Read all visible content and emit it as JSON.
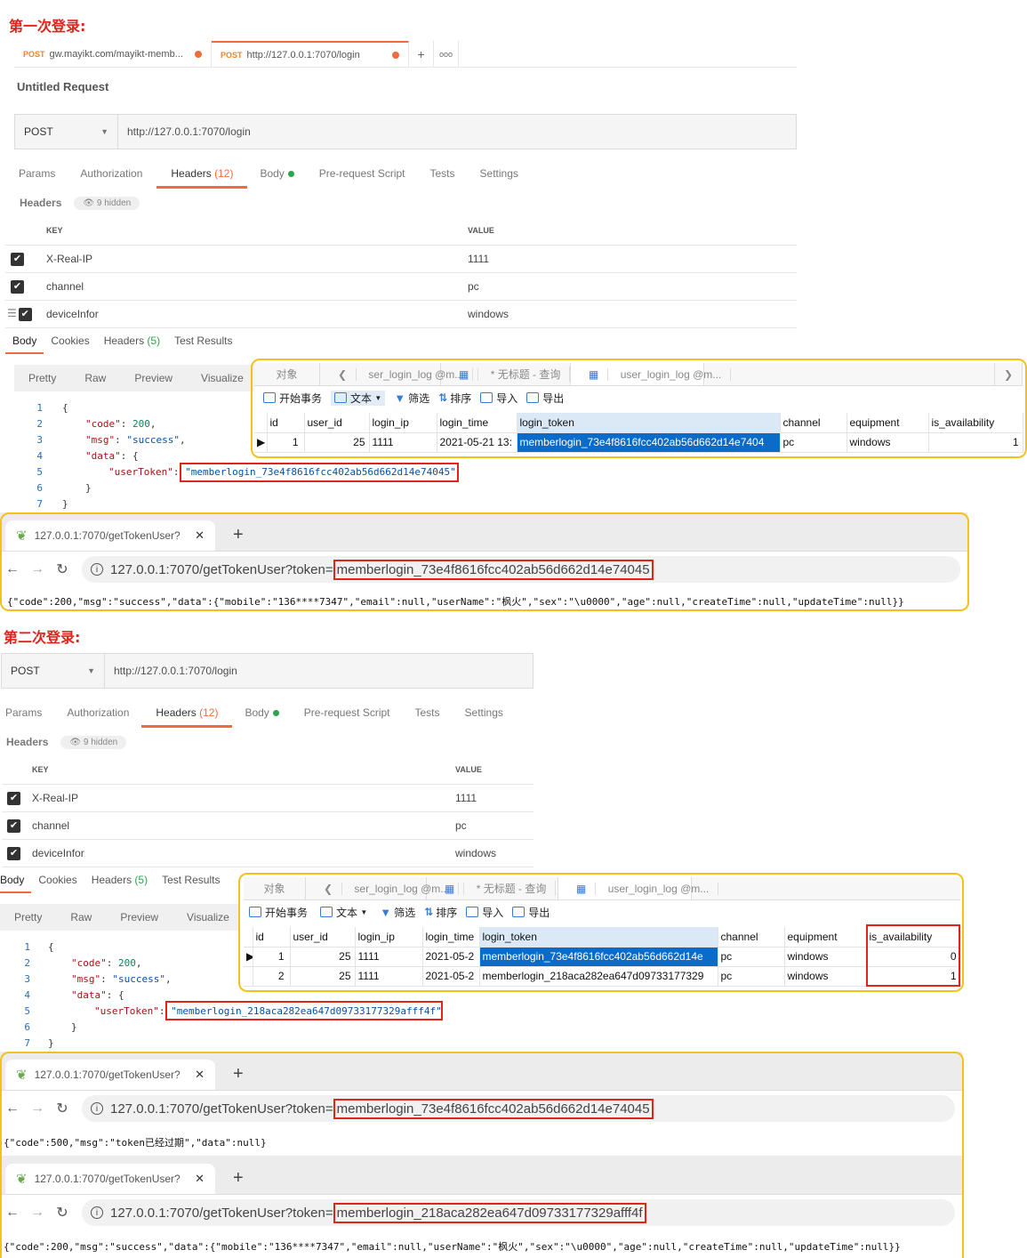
{
  "headings": {
    "first": "第一次登录:",
    "second": "第二次登录:"
  },
  "postman1": {
    "tabs": [
      {
        "method": "POST",
        "label": "gw.mayikt.com/mayikt-memb..."
      },
      {
        "method": "POST",
        "label": "http://127.0.0.1:7070/login"
      }
    ],
    "tab_plus": "+",
    "tab_more": "ooo",
    "request_title": "Untitled Request",
    "method": "POST",
    "url": "http://127.0.0.1:7070/login",
    "req_tabs": [
      "Params",
      "Authorization",
      "Headers",
      "(12)",
      "Body",
      "Pre-request Script",
      "Tests",
      "Settings"
    ],
    "headers_label": "Headers",
    "hidden_label": "9 hidden",
    "key_col": "KEY",
    "value_col": "VALUE",
    "rows": [
      {
        "key": "X-Real-IP",
        "value": "1111"
      },
      {
        "key": "channel",
        "value": "pc"
      },
      {
        "key": "deviceInfor",
        "value": "windows"
      }
    ],
    "resp_tabs": [
      "Body",
      "Cookies",
      "Headers",
      "(5)",
      "Test Results"
    ],
    "view_tabs": [
      "Pretty",
      "Raw",
      "Preview",
      "Visualize"
    ],
    "code": {
      "k_code": "\"code\"",
      "v_code": "200",
      "k_msg": "\"msg\"",
      "v_msg": "\"success\"",
      "k_data": "\"data\"",
      "k_token": "\"userToken\"",
      "v_token": "\"memberlogin_73e4f8616fcc402ab56d662d14e74045\""
    },
    "line_numbers": [
      "1",
      "2",
      "3",
      "4",
      "5",
      "6",
      "7"
    ]
  },
  "navicat1": {
    "tabs": [
      "对象",
      "ser_login_log @m...",
      "* 无标题 - 查询",
      "user_login_log @m..."
    ],
    "tools": [
      "开始事务",
      "文本",
      "筛选",
      "排序",
      "导入",
      "导出"
    ],
    "columns": [
      "id",
      "user_id",
      "login_ip",
      "login_time",
      "login_token",
      "channel",
      "equipment",
      "is_availability"
    ],
    "rows": [
      [
        "1",
        "25",
        "1111",
        "2021-05-21 13:",
        "memberlogin_73e4f8616fcc402ab56d662d14e7404",
        "pc",
        "windows",
        "1"
      ]
    ]
  },
  "browser1": {
    "tab_title": "127.0.0.1:7070/getTokenUser?",
    "url_prefix": "127.0.0.1:7070/getTokenUser?token=",
    "url_token": "memberlogin_73e4f8616fcc402ab56d662d14e74045",
    "response": "{\"code\":200,\"msg\":\"success\",\"data\":{\"mobile\":\"136****7347\",\"email\":null,\"userName\":\"枫火\",\"sex\":\"\\u0000\",\"age\":null,\"createTime\":null,\"updateTime\":null}}"
  },
  "postman2": {
    "method": "POST",
    "url": "http://127.0.0.1:7070/login",
    "req_tabs": [
      "Params",
      "Authorization",
      "Headers",
      "(12)",
      "Body",
      "Pre-request Script",
      "Tests",
      "Settings"
    ],
    "headers_label": "Headers",
    "hidden_label": "9 hidden",
    "key_col": "KEY",
    "value_col": "VALUE",
    "rows": [
      {
        "key": "X-Real-IP",
        "value": "1111"
      },
      {
        "key": "channel",
        "value": "pc"
      },
      {
        "key": "deviceInfor",
        "value": "windows"
      }
    ],
    "resp_tabs": [
      "Body",
      "Cookies",
      "Headers",
      "(5)",
      "Test Results"
    ],
    "view_tabs": [
      "Pretty",
      "Raw",
      "Preview",
      "Visualize"
    ],
    "code": {
      "k_code": "\"code\"",
      "v_code": "200",
      "k_msg": "\"msg\"",
      "v_msg": "\"success\"",
      "k_data": "\"data\"",
      "k_token": "\"userToken\"",
      "v_token": "\"memberlogin_218aca282ea647d09733177329afff4f\""
    },
    "line_numbers": [
      "1",
      "2",
      "3",
      "4",
      "5",
      "6",
      "7"
    ]
  },
  "navicat2": {
    "tabs": [
      "对象",
      "ser_login_log @m...",
      "* 无标题 - 查询",
      "user_login_log @m..."
    ],
    "tools": [
      "开始事务",
      "文本",
      "筛选",
      "排序",
      "导入",
      "导出"
    ],
    "columns": [
      "id",
      "user_id",
      "login_ip",
      "login_time",
      "login_token",
      "channel",
      "equipment",
      "is_availability"
    ],
    "rows": [
      [
        "1",
        "25",
        "1111",
        "2021-05-2",
        "memberlogin_73e4f8616fcc402ab56d662d14e",
        "pc",
        "windows",
        "0"
      ],
      [
        "2",
        "25",
        "1111",
        "2021-05-2",
        "memberlogin_218aca282ea647d09733177329",
        "pc",
        "windows",
        "1"
      ]
    ]
  },
  "browser2": {
    "tab_title": "127.0.0.1:7070/getTokenUser?",
    "url_prefix": "127.0.0.1:7070/getTokenUser?token=",
    "url_token": "memberlogin_73e4f8616fcc402ab56d662d14e74045",
    "response": "{\"code\":500,\"msg\":\"token已经过期\",\"data\":null}"
  },
  "browser3": {
    "tab_title": "127.0.0.1:7070/getTokenUser?",
    "url_prefix": "127.0.0.1:7070/getTokenUser?token=",
    "url_token": "memberlogin_218aca282ea647d09733177329afff4f",
    "response": "{\"code\":200,\"msg\":\"success\",\"data\":{\"mobile\":\"136****7347\",\"email\":null,\"userName\":\"枫火\",\"sex\":\"\\u0000\",\"age\":null,\"createTime\":null,\"updateTime\":null}}"
  }
}
